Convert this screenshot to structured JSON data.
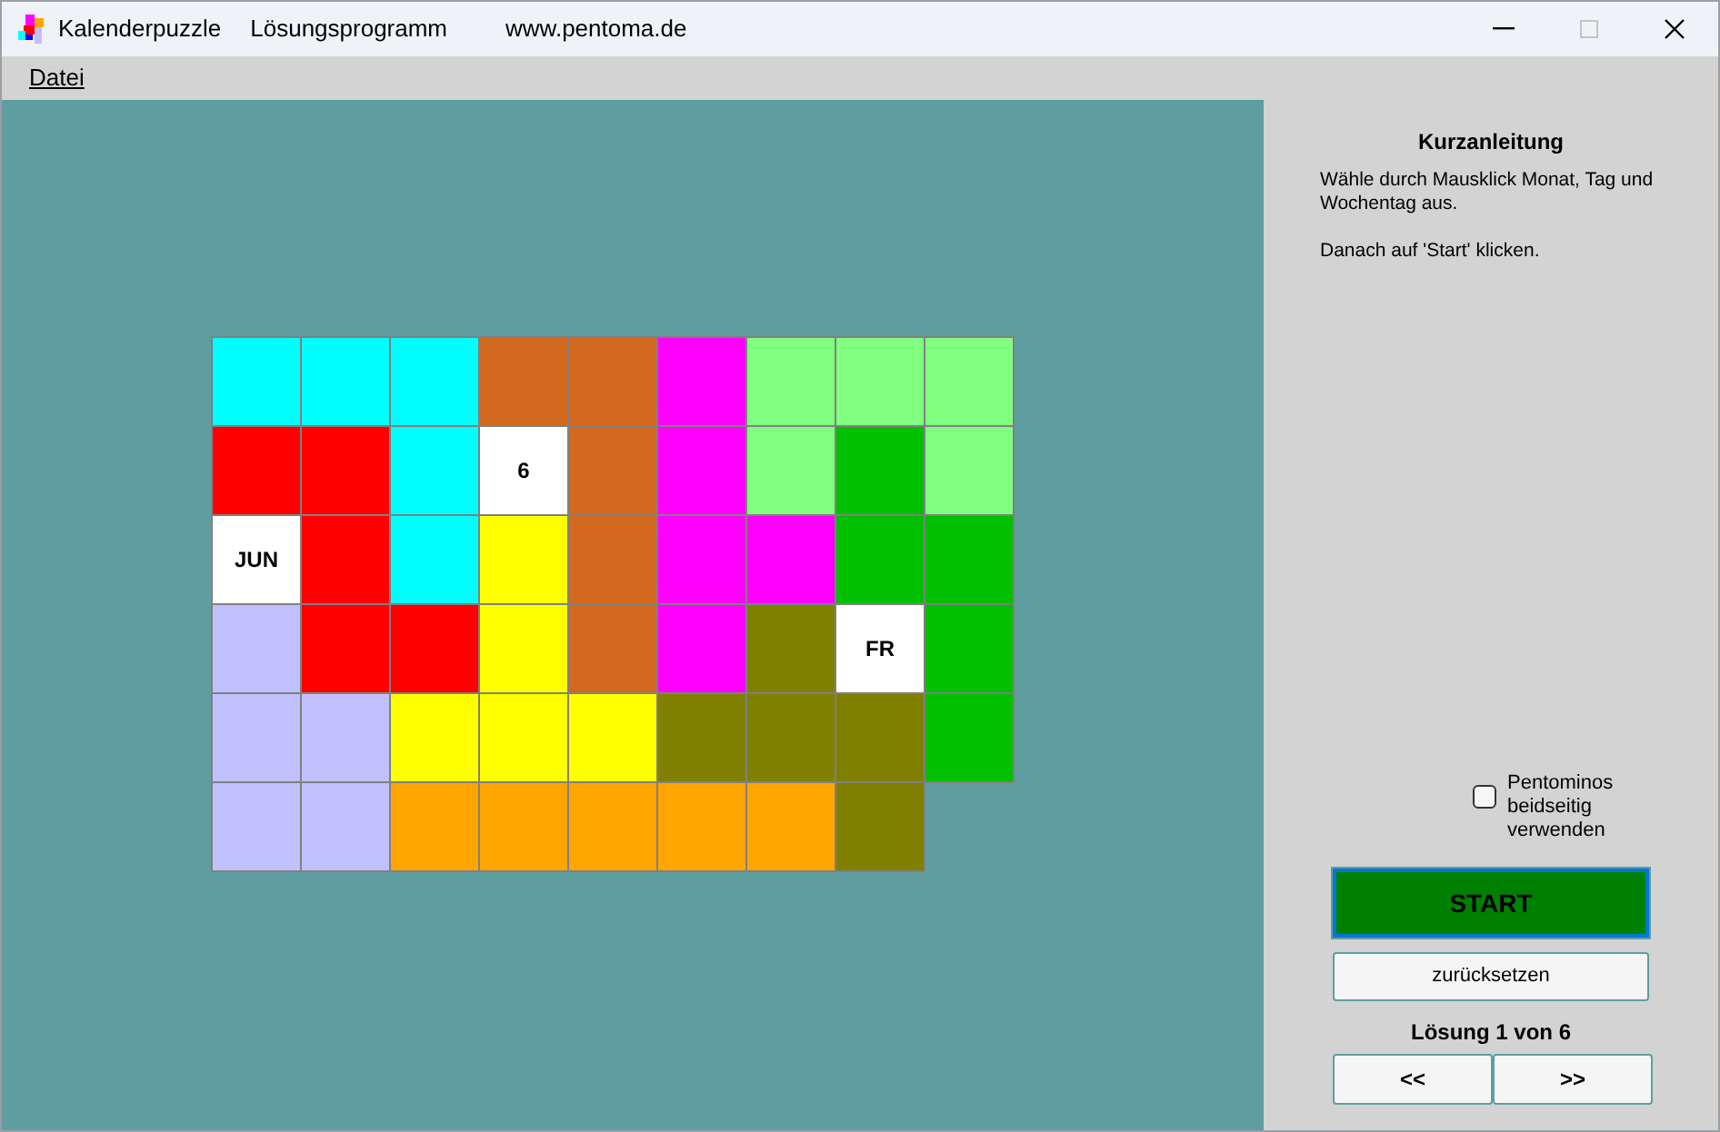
{
  "window": {
    "title_parts": [
      "Kalenderpuzzle",
      "Lösungsprogramm",
      "www.pentoma.de"
    ]
  },
  "menu": [
    "Datei"
  ],
  "board": {
    "rows": [
      [
        {
          "color": "#00ffff"
        },
        {
          "color": "#00ffff"
        },
        {
          "color": "#00ffff"
        },
        {
          "color": "#d2691e"
        },
        {
          "color": "#d2691e"
        },
        {
          "color": "#ff00ff"
        },
        {
          "color": "#80ff80"
        },
        {
          "color": "#80ff80"
        },
        {
          "color": "#80ff80"
        }
      ],
      [
        {
          "color": "#ff0000"
        },
        {
          "color": "#ff0000"
        },
        {
          "color": "#00ffff"
        },
        {
          "label": "6"
        },
        {
          "color": "#d2691e"
        },
        {
          "color": "#ff00ff"
        },
        {
          "color": "#80ff80"
        },
        {
          "color": "#00c000"
        },
        {
          "color": "#80ff80"
        }
      ],
      [
        {
          "label": "JUN"
        },
        {
          "color": "#ff0000"
        },
        {
          "color": "#00ffff"
        },
        {
          "color": "#ffff00"
        },
        {
          "color": "#d2691e"
        },
        {
          "color": "#ff00ff"
        },
        {
          "color": "#ff00ff"
        },
        {
          "color": "#00c000"
        },
        {
          "color": "#00c000"
        }
      ],
      [
        {
          "color": "#c0c0ff"
        },
        {
          "color": "#ff0000"
        },
        {
          "color": "#ff0000"
        },
        {
          "color": "#ffff00"
        },
        {
          "color": "#d2691e"
        },
        {
          "color": "#ff00ff"
        },
        {
          "color": "#808000"
        },
        {
          "label": "FR"
        },
        {
          "color": "#00c000"
        }
      ],
      [
        {
          "color": "#c0c0ff"
        },
        {
          "color": "#c0c0ff"
        },
        {
          "color": "#ffff00"
        },
        {
          "color": "#ffff00"
        },
        {
          "color": "#ffff00"
        },
        {
          "color": "#808000"
        },
        {
          "color": "#808000"
        },
        {
          "color": "#808000"
        },
        {
          "color": "#00c000"
        }
      ],
      [
        {
          "color": "#c0c0ff"
        },
        {
          "color": "#c0c0ff"
        },
        {
          "color": "#ffa500"
        },
        {
          "color": "#ffa500"
        },
        {
          "color": "#ffa500"
        },
        {
          "color": "#ffa500"
        },
        {
          "color": "#ffa500"
        },
        {
          "color": "#808000"
        }
      ]
    ]
  },
  "instructions": {
    "title": "Kurzanleitung",
    "paragraphs": [
      "Wähle durch Mausklick Monat, Tag und Wochentag aus.",
      "Danach auf 'Start' klicken."
    ]
  },
  "option": {
    "label": "Pentominos beidseitig verwenden",
    "checked": false
  },
  "start_button": "START",
  "reset_button": "zurücksetzen",
  "solution_status": "Lösung 1 von 6",
  "nav_buttons": [
    "<<",
    ">>"
  ]
}
